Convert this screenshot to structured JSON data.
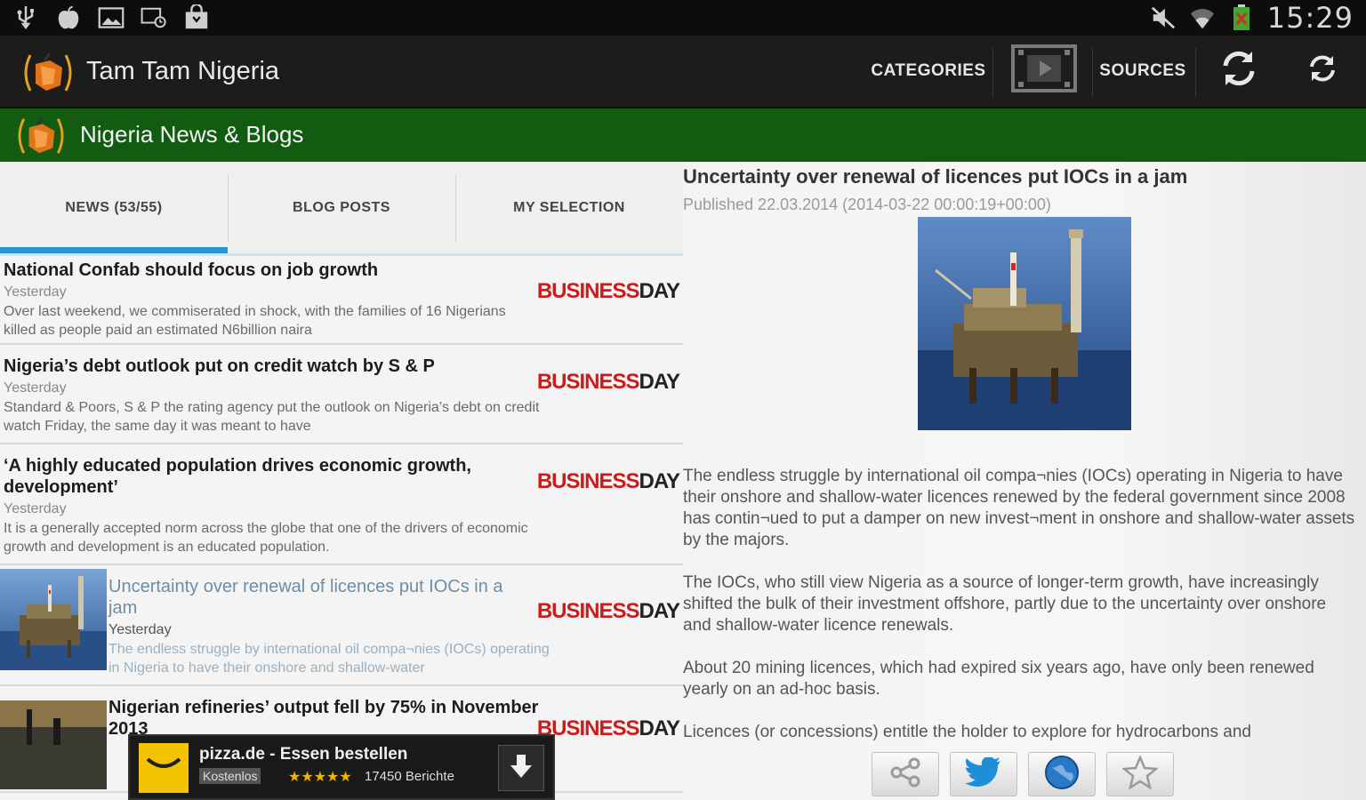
{
  "status_bar": {
    "icons_left": [
      "usb-icon",
      "apple-icon",
      "image-icon",
      "sync-screen-icon",
      "shopping-bag-icon"
    ],
    "icons_right": [
      "mute-icon",
      "wifi-icon",
      "battery-icon"
    ],
    "time": "15:29"
  },
  "action_bar": {
    "app_title": "Tam Tam Nigeria",
    "categories_label": "CATEGORIES",
    "sources_label": "SOURCES",
    "video_icon": "film-icon",
    "sync_icon": "sync-icon",
    "refresh_icon": "refresh-icon"
  },
  "sub_bar": {
    "title": "Nigeria News & Blogs"
  },
  "tabs": [
    {
      "label": "NEWS (53/55)"
    },
    {
      "label": "BLOG POSTS"
    },
    {
      "label": "MY SELECTION"
    }
  ],
  "news_items": [
    {
      "title": "National Confab should focus on job growth",
      "date": "Yesterday",
      "snippet": "Over last weekend, we commiserated in shock, with the families of 16 Nigerians killed as people paid an estimated N6billion naira",
      "source_a": "BUSINESS",
      "source_b": "DAY"
    },
    {
      "title": "Nigeria’s debt outlook put on credit watch by S & P",
      "date": "Yesterday",
      "snippet": "Standard & Poors, S & P the rating agency put the outlook on Nigeria’s debt on credit watch Friday, the same day it was meant to have",
      "source_a": "BUSINESS",
      "source_b": "DAY"
    },
    {
      "title": "‘A highly educated population drives economic growth, development’",
      "date": "Yesterday",
      "snippet": "It is a generally accepted norm across the globe that one of the drivers of economic growth and development is an educated population.",
      "source_a": "BUSINESS",
      "source_b": "DAY"
    },
    {
      "title": "Uncertainty over renewal of licences put IOCs in a jam",
      "date": "Yesterday",
      "snippet": "The endless struggle by international oil compa¬nies (IOCs) operating in Nigeria to have their onshore and shallow-water",
      "source_a": "BUSINESS",
      "source_b": "DAY"
    },
    {
      "title": "Nigerian refineries’ output fell by 75% in November 2013",
      "date": "",
      "snippet": "",
      "source_a": "BUSINESS",
      "source_b": "DAY"
    }
  ],
  "ad": {
    "title": "pizza.de - Essen bestellen",
    "badge": "Kostenlos",
    "stars": "★★★★★",
    "count": "17450 Berichte",
    "logo_text": "pizza.de"
  },
  "article": {
    "title": "Uncertainty over renewal of licences put IOCs in a jam",
    "published": "Published 22.03.2014 (2014-03-22 00:00:19+00:00)",
    "paragraphs": [
      "The endless struggle by international oil compa¬nies (IOCs) operating in Nigeria to have their onshore and shallow-water licences renewed by the federal government since 2008 has contin¬ued to put a damper on new invest¬ment in onshore and shallow-water assets by the majors.",
      "The IOCs, who still view Nigeria as a source of longer-term growth, have increasingly shifted the bulk of their investment offshore, partly due to the uncertainty over onshore and shallow-water licence renewals.",
      "About 20 mining licences, which had expired six years ago, have only been renewed yearly on an ad-hoc basis.",
      "Licences (or concessions) entitle the holder to explore for hydrocarbons and"
    ]
  },
  "share_bar": [
    "share-icon",
    "twitter-icon",
    "browser-globe-icon",
    "star-favorite-icon"
  ],
  "colors": {
    "green_bar": "#125c12",
    "tab_indicator": "#2a93d5",
    "businessday_red": "#cc1b1b"
  }
}
